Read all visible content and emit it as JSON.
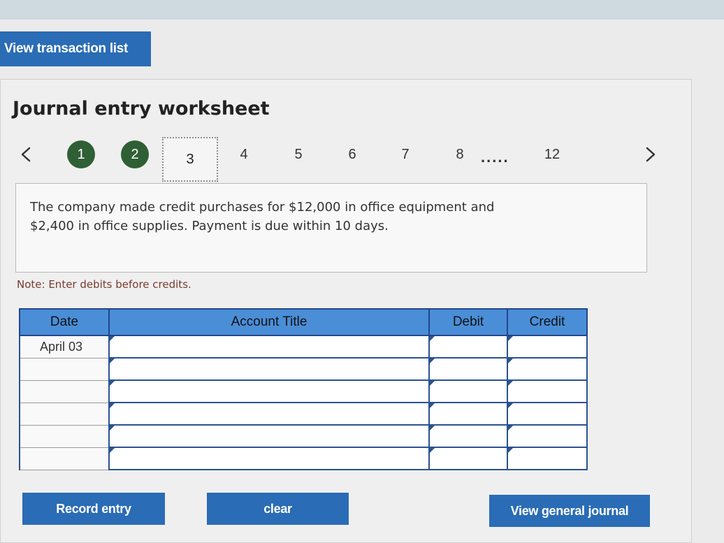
{
  "header": {
    "view_transaction_list": "View transaction list"
  },
  "worksheet": {
    "title": "Journal entry worksheet",
    "steps": [
      {
        "label": "1",
        "state": "completed"
      },
      {
        "label": "2",
        "state": "completed"
      },
      {
        "label": "3",
        "state": "current"
      },
      {
        "label": "4",
        "state": "default"
      },
      {
        "label": "5",
        "state": "default"
      },
      {
        "label": "6",
        "state": "default"
      },
      {
        "label": "7",
        "state": "default"
      },
      {
        "label": "8",
        "state": "default"
      },
      {
        "label": "12",
        "state": "default"
      }
    ],
    "ellipsis": ".....",
    "prompt_line1": "The company made credit purchases for $12,000 in office equipment and",
    "prompt_line2": "$2,400 in office supplies. Payment is due within 10 days.",
    "note": "Note: Enter debits before credits."
  },
  "table": {
    "headers": {
      "date": "Date",
      "account": "Account Title",
      "debit": "Debit",
      "credit": "Credit"
    },
    "rows": [
      {
        "date": "April 03",
        "account": "",
        "debit": "",
        "credit": ""
      },
      {
        "date": "",
        "account": "",
        "debit": "",
        "credit": ""
      },
      {
        "date": "",
        "account": "",
        "debit": "",
        "credit": ""
      },
      {
        "date": "",
        "account": "",
        "debit": "",
        "credit": ""
      },
      {
        "date": "",
        "account": "",
        "debit": "",
        "credit": ""
      },
      {
        "date": "",
        "account": "",
        "debit": "",
        "credit": ""
      }
    ]
  },
  "actions": {
    "record_entry": "Record entry",
    "clear": "clear",
    "view_general_journal": "View general journal"
  },
  "colors": {
    "accent_blue": "#2a6cb5",
    "header_blue": "#4a8ed8",
    "completed_step": "#2f5f34",
    "note_text": "#7a3a30"
  },
  "icons": {
    "prev": "chevron-left-icon",
    "next": "chevron-right-icon"
  }
}
